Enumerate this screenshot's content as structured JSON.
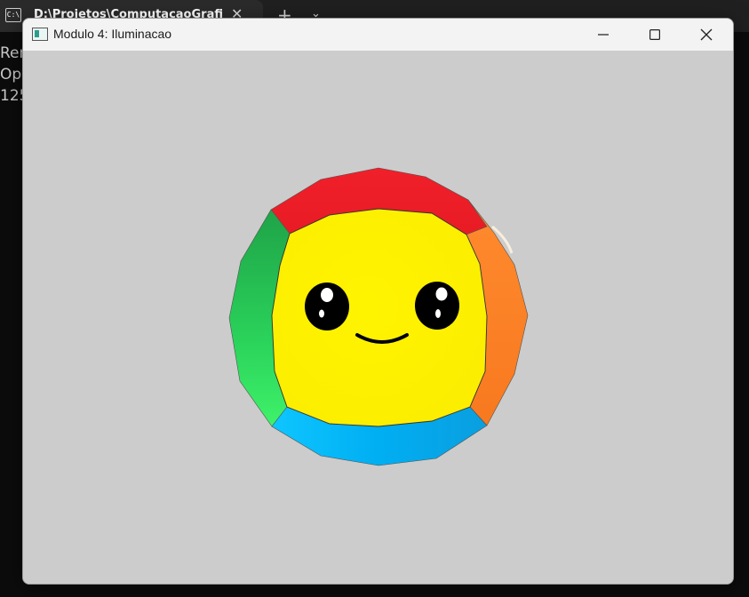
{
  "terminal": {
    "tab_title": "D:\\Projetos\\ComputacaoGrafi",
    "tab_icon_text": "C:\\",
    "new_tab": "+",
    "dropdown": "⌄",
    "close": "✕",
    "lines": [
      "Ren",
      "Ope",
      "125"
    ]
  },
  "window": {
    "title": "Modulo 4: Iluminacao"
  },
  "scene": {
    "background": "#cccccc",
    "colors": {
      "top": "#ee1c25",
      "left": "#22b14c",
      "right": "#ff7f27",
      "bottom": "#00a2e8",
      "front": "#fff200",
      "eyes": "#000000"
    }
  }
}
